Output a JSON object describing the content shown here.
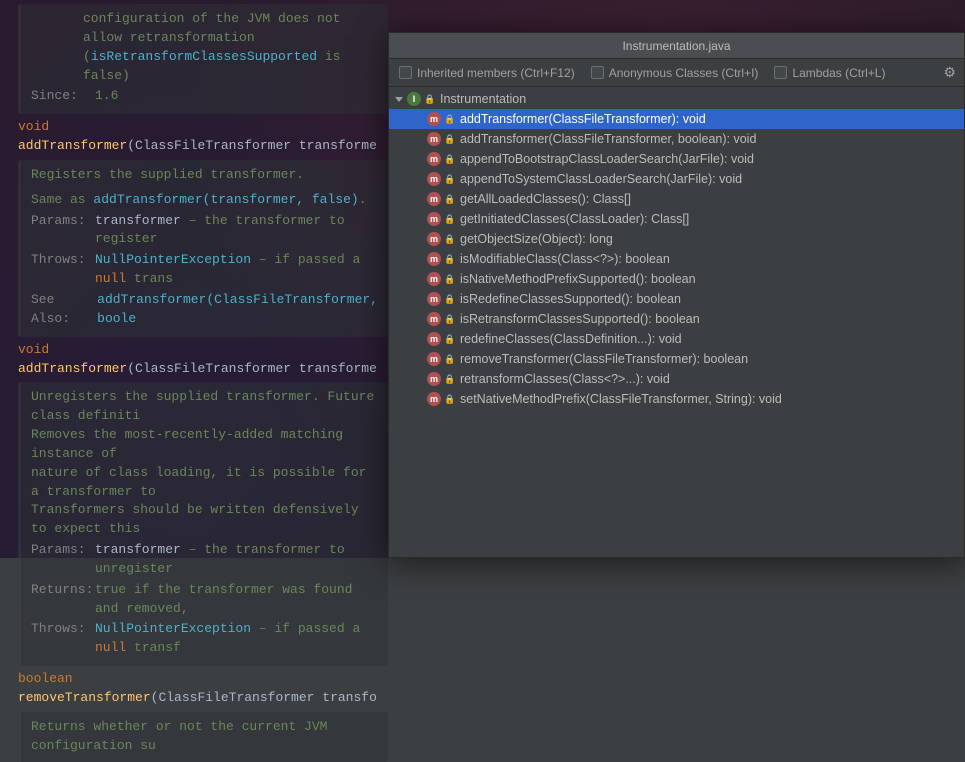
{
  "doc": {
    "block1": {
      "line1": "configuration of the JVM does not allow retransformation",
      "line2_pre": "(",
      "line2_code": "isRetransformClassesSupported",
      "line2_post": " is false)",
      "since_label": "Since:",
      "since_val": "1.6"
    },
    "sig1": {
      "type": "void",
      "name": "addTransformer",
      "open": "(",
      "ptype": "ClassFileTransformer",
      "pname": "transforme"
    },
    "block2": {
      "title": "Registers the supplied transformer.",
      "same_pre": "Same as ",
      "same_code": "addTransformer(transformer, false)",
      "same_post": ".",
      "params_label": "Params:",
      "params_name": "transformer",
      "params_desc": " – the transformer to register",
      "throws_label": "Throws:",
      "throws_code": "NullPointerException",
      "throws_desc": " – if passed a ",
      "throws_kw": "null",
      "throws_tail": " trans",
      "see_label": "See Also:",
      "see_code": "addTransformer(ClassFileTransformer, boole"
    },
    "sig2": {
      "type": "void",
      "name": "addTransformer",
      "open": "(",
      "ptype": "ClassFileTransformer",
      "pname": "transforme"
    },
    "block3": {
      "l1": "Unregisters the supplied transformer. Future class definiti",
      "l2": "Removes the most-recently-added matching instance of ",
      "l3": "nature of class loading, it is possible for a transformer to ",
      "l4": "Transformers should be written defensively to expect this",
      "params_label": "Params:",
      "params_name": "transformer",
      "params_desc": " – the transformer to unregister",
      "returns_label": "Returns:",
      "returns_desc": "true if the transformer was found and removed,",
      "throws_label": "Throws:",
      "throws_code": "NullPointerException",
      "throws_desc": " – if passed a ",
      "throws_kw": "null",
      "throws_tail": " transf"
    },
    "sig3": {
      "type": "boolean",
      "name": "removeTransformer",
      "open": "(",
      "ptype": "ClassFileTransformer",
      "pname": "transfo"
    },
    "cut": "Returns whether or not the current JVM configuration su"
  },
  "popup": {
    "title": "Instrumentation.java",
    "opts": {
      "inherited": "Inherited members (Ctrl+F12)",
      "anonymous": "Anonymous Classes (Ctrl+I)",
      "lambdas": "Lambdas (Ctrl+L)"
    },
    "root_label": "Instrumentation",
    "methods": [
      "addTransformer(ClassFileTransformer): void",
      "addTransformer(ClassFileTransformer, boolean): void",
      "appendToBootstrapClassLoaderSearch(JarFile): void",
      "appendToSystemClassLoaderSearch(JarFile): void",
      "getAllLoadedClasses(): Class[]",
      "getInitiatedClasses(ClassLoader): Class[]",
      "getObjectSize(Object): long",
      "isModifiableClass(Class<?>): boolean",
      "isNativeMethodPrefixSupported(): boolean",
      "isRedefineClassesSupported(): boolean",
      "isRetransformClassesSupported(): boolean",
      "redefineClasses(ClassDefinition...): void",
      "removeTransformer(ClassFileTransformer): boolean",
      "retransformClasses(Class<?>...): void",
      "setNativeMethodPrefix(ClassFileTransformer, String): void"
    ],
    "letters": {
      "interface": "I",
      "method": "m"
    }
  }
}
